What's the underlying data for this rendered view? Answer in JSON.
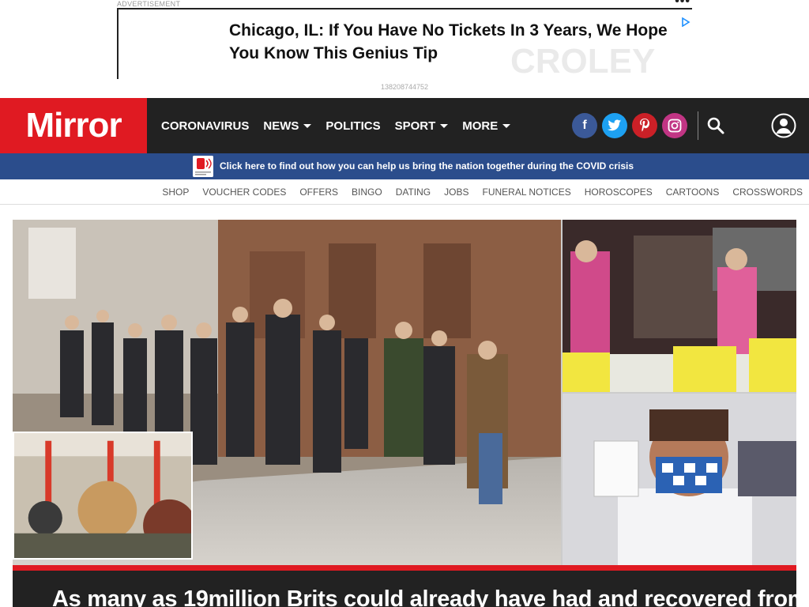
{
  "ad": {
    "label": "ADVERTISEMENT",
    "headline": "Chicago, IL: If You Have No Tickets In 3 Years, We Hope You Know This Genius Tip",
    "id": "138208744752",
    "menu_icon": "more-dots-icon",
    "choices_icon": "adchoices-icon"
  },
  "header": {
    "logo": "Mirror",
    "brand_color": "#e01a22",
    "nav": [
      {
        "label": "CORONAVIRUS",
        "has_dropdown": false
      },
      {
        "label": "NEWS",
        "has_dropdown": true
      },
      {
        "label": "POLITICS",
        "has_dropdown": false
      },
      {
        "label": "SPORT",
        "has_dropdown": true
      },
      {
        "label": "MORE",
        "has_dropdown": true
      }
    ],
    "social": [
      "facebook-icon",
      "twitter-icon",
      "pinterest-icon",
      "instagram-icon"
    ],
    "search_icon": "search-icon",
    "account_icon": "account-icon"
  },
  "covid_banner": {
    "text": "Click here to find out how you can help us bring the nation together during the COVID crisis",
    "color": "#2b4d8c"
  },
  "subnav": [
    "SHOP",
    "VOUCHER CODES",
    "OFFERS",
    "BINGO",
    "DATING",
    "JOBS",
    "FUNERAL NOTICES",
    "HOROSCOPES",
    "CARTOONS",
    "CROSSWORDS"
  ],
  "hero": {
    "headline": "As many as 19million Brits could already have had and recovered from"
  }
}
